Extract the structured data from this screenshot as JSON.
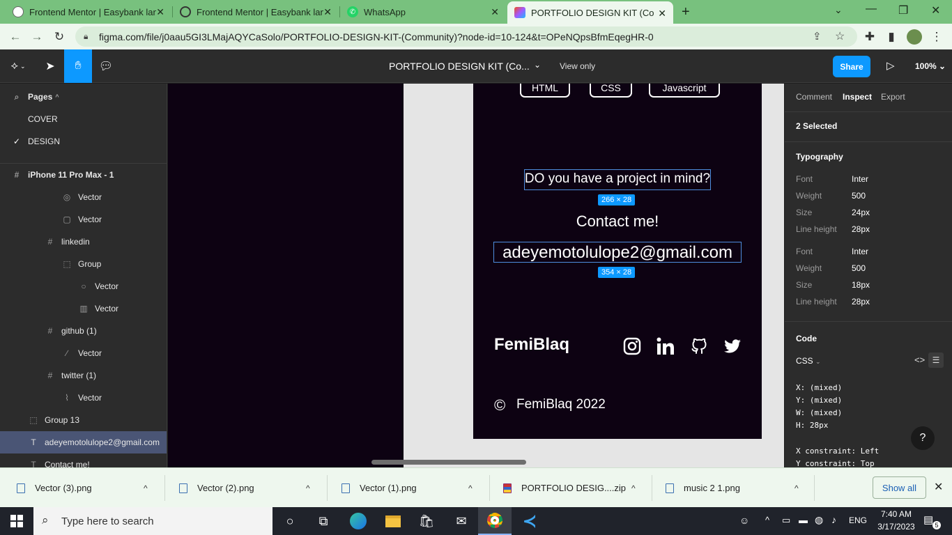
{
  "browser": {
    "tabs": [
      {
        "title": "Frontend Mentor | Easybank landing page",
        "icon": "frontend-mentor-icon"
      },
      {
        "title": "Frontend Mentor | Easybank landing page",
        "icon": "globe-icon"
      },
      {
        "title": "WhatsApp",
        "icon": "whatsapp-icon"
      },
      {
        "title": "PORTFOLIO DESIGN KIT (Community)",
        "icon": "figma-icon"
      }
    ],
    "url": "figma.com/file/j0aau5GI3LMajAQYCaSolo/PORTFOLIO-DESIGN-KIT-(Community)?node-id=10-124&t=OPeNQpsBfmEqegHR-0"
  },
  "toolbar": {
    "file_title": "PORTFOLIO DESIGN KIT (Co...",
    "view_only": "View only",
    "share": "Share",
    "zoom": "100%"
  },
  "left_panel": {
    "pages_label": "Pages",
    "pages": [
      "COVER",
      "DESIGN"
    ],
    "frame": "iPhone 11 Pro Max - 1",
    "layers": [
      {
        "label": "Vector",
        "icon": "vector-icon"
      },
      {
        "label": "Vector",
        "icon": "vector-icon"
      },
      {
        "label": "linkedin",
        "icon": "frame-icon"
      },
      {
        "label": "Group",
        "icon": "group-icon"
      },
      {
        "label": "Vector",
        "icon": "vector-icon"
      },
      {
        "label": "Vector",
        "icon": "vector-icon"
      },
      {
        "label": "github (1)",
        "icon": "frame-icon"
      },
      {
        "label": "Vector",
        "icon": "vector-icon"
      },
      {
        "label": "twitter (1)",
        "icon": "frame-icon"
      },
      {
        "label": "Vector",
        "icon": "vector-icon"
      },
      {
        "label": "Group 13",
        "icon": "group-icon"
      },
      {
        "label": "adeyemotolulope2@gmail.com",
        "icon": "text-icon"
      },
      {
        "label": "Contact me!",
        "icon": "text-icon"
      }
    ]
  },
  "canvas": {
    "skills": [
      "HTML",
      "CSS",
      "Javascript"
    ],
    "question": "DO you have a project in mind?",
    "question_dim": "266 × 28",
    "contact": "Contact me!",
    "email": "adeyemotolulope2@gmail.com",
    "email_dim": "354 × 28",
    "brand": "FemiBlaq",
    "copyright": "FemiBlaq 2022",
    "copyright_symbol": "©"
  },
  "right_panel": {
    "tabs": [
      "Comment",
      "Inspect",
      "Export"
    ],
    "selected": "2 Selected",
    "typography_label": "Typography",
    "typo1": {
      "font_k": "Font",
      "font": "Inter",
      "weight_k": "Weight",
      "weight": "500",
      "size_k": "Size",
      "size": "24px",
      "lh_k": "Line height",
      "lh": "28px"
    },
    "typo2": {
      "font_k": "Font",
      "font": "Inter",
      "weight_k": "Weight",
      "weight": "500",
      "size_k": "Size",
      "size": "18px",
      "lh_k": "Line height",
      "lh": "28px"
    },
    "code_label": "Code",
    "code_lang": "CSS",
    "code_lines": [
      "X: (mixed)",
      "Y: (mixed)",
      "W: (mixed)",
      "H: 28px"
    ],
    "constraints": [
      "X constraint: Left",
      "Y constraint: Top"
    ],
    "help": "?"
  },
  "downloads": {
    "items": [
      "Vector (3).png",
      "Vector (2).png",
      "Vector (1).png",
      "PORTFOLIO DESIG....zip",
      "music 2 1.png"
    ],
    "show_all": "Show all"
  },
  "taskbar": {
    "search_placeholder": "Type here to search",
    "lang": "ENG",
    "time": "7:40 AM",
    "date": "3/17/2023",
    "notifications": "5"
  }
}
